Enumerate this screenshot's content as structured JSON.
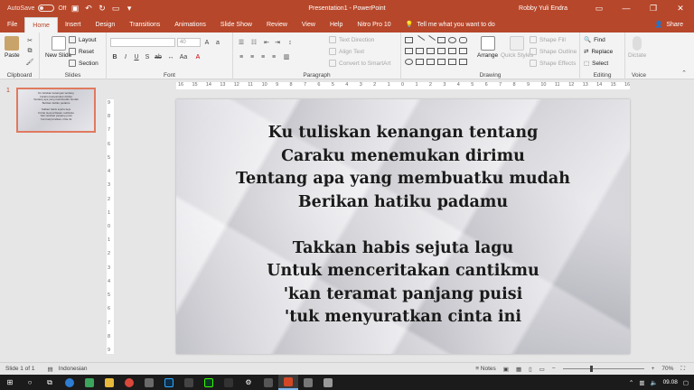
{
  "titlebar": {
    "autosave_label": "AutoSave",
    "autosave_state": "Off",
    "document_title": "Presentation1 - PowerPoint",
    "user_name": "Robby Yuli Endra"
  },
  "tabs": [
    {
      "label": "File"
    },
    {
      "label": "Home"
    },
    {
      "label": "Insert"
    },
    {
      "label": "Design"
    },
    {
      "label": "Transitions"
    },
    {
      "label": "Animations"
    },
    {
      "label": "Slide Show"
    },
    {
      "label": "Review"
    },
    {
      "label": "View"
    },
    {
      "label": "Help"
    },
    {
      "label": "Nitro Pro 10"
    }
  ],
  "active_tab": "Home",
  "tellme": {
    "placeholder": "Tell me what you want to do"
  },
  "share_label": "Share",
  "ribbon": {
    "clipboard": {
      "group_label": "Clipboard",
      "paste": "Paste"
    },
    "slides": {
      "group_label": "Slides",
      "new_slide": "New Slide",
      "layout": "Layout",
      "reset": "Reset",
      "section": "Section"
    },
    "font": {
      "group_label": "Font",
      "size": "40"
    },
    "paragraph": {
      "group_label": "Paragraph",
      "text_direction": "Text Direction",
      "align_text": "Align Text",
      "convert_smartart": "Convert to SmartArt"
    },
    "drawing": {
      "group_label": "Drawing",
      "arrange": "Arrange",
      "quick_styles": "Quick Styles",
      "shape_fill": "Shape Fill",
      "shape_outline": "Shape Outline",
      "shape_effects": "Shape Effects"
    },
    "editing": {
      "group_label": "Editing",
      "find": "Find",
      "replace": "Replace",
      "select": "Select"
    },
    "voice": {
      "group_label": "Voice",
      "dictate": "Dictate"
    }
  },
  "thumbnail": {
    "number": "1"
  },
  "slide_lines": [
    "Ku tuliskan kenangan tentang",
    "Caraku menemukan dirimu",
    "Tentang apa yang membuatku mudah",
    "Berikan hatiku padamu",
    "",
    "Takkan habis sejuta lagu",
    "Untuk menceritakan cantikmu",
    "'kan teramat panjang puisi",
    "'tuk menyuratkan cinta ini"
  ],
  "hruler_labels": [
    "16",
    "15",
    "14",
    "13",
    "12",
    "11",
    "10",
    "9",
    "8",
    "7",
    "6",
    "5",
    "4",
    "3",
    "2",
    "1",
    "0",
    "1",
    "2",
    "3",
    "4",
    "5",
    "6",
    "7",
    "8",
    "9",
    "10",
    "11",
    "12",
    "13",
    "14",
    "15",
    "16"
  ],
  "vruler_labels": [
    "9",
    "8",
    "7",
    "6",
    "5",
    "4",
    "3",
    "2",
    "1",
    "0",
    "1",
    "2",
    "3",
    "4",
    "5",
    "6",
    "7",
    "8",
    "9"
  ],
  "statusbar": {
    "slide_info": "Slide 1 of 1",
    "language": "Indonesian",
    "notes": "Notes",
    "zoom": "70%"
  },
  "taskbar": {
    "time": "09.08"
  },
  "colors": {
    "accent": "#b7472a",
    "ribbon_bg": "#f3f3f3",
    "taskbar_bg": "#1b1b1b"
  }
}
